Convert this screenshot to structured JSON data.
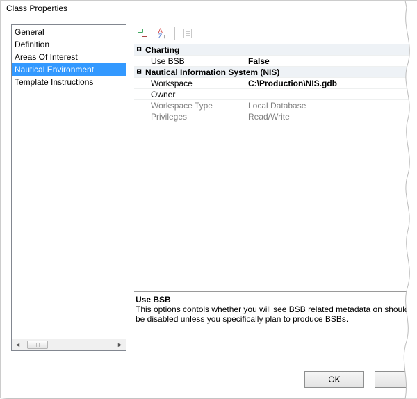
{
  "title": "Class Properties",
  "sidebar": {
    "items": [
      {
        "label": "General"
      },
      {
        "label": "Definition"
      },
      {
        "label": "Areas Of Interest"
      },
      {
        "label": "Nautical Environment"
      },
      {
        "label": "Template Instructions"
      }
    ],
    "selected_index": 3
  },
  "toolbar": {
    "categorized_tooltip": "Categorized",
    "alphabetical_tooltip": "Alphabetical",
    "propertypages_tooltip": "Property Pages"
  },
  "grid": {
    "categories": [
      {
        "name": "Charting",
        "expanded": true,
        "rows": [
          {
            "label": "Use BSB",
            "value": "False",
            "bold": true,
            "readonly": false
          }
        ]
      },
      {
        "name": "Nautical Information System (NIS)",
        "expanded": true,
        "rows": [
          {
            "label": "Workspace",
            "value": "C:\\Production\\NIS.gdb",
            "bold": true,
            "readonly": false
          },
          {
            "label": "Owner",
            "value": "",
            "bold": false,
            "readonly": false
          },
          {
            "label": "Workspace Type",
            "value": "Local Database",
            "bold": false,
            "readonly": true
          },
          {
            "label": "Privileges",
            "value": "Read/Write",
            "bold": false,
            "readonly": true
          }
        ]
      }
    ]
  },
  "help": {
    "title": "Use BSB",
    "text": "This options contols whether you will see BSB related metadata on should be disabled unless you specifically plan to produce BSBs."
  },
  "buttons": {
    "ok": "OK"
  }
}
